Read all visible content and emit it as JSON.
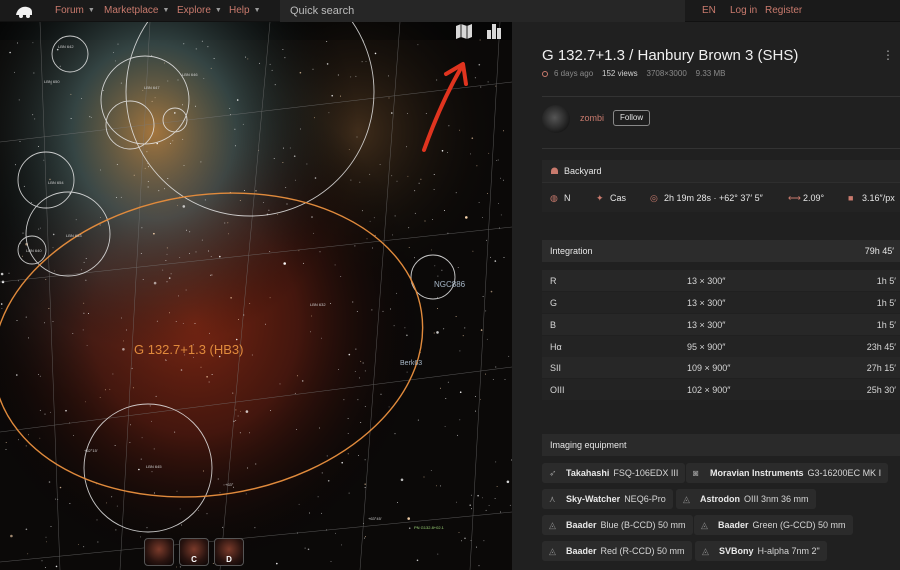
{
  "nav": {
    "items": [
      {
        "label": "Forum"
      },
      {
        "label": "Marketplace"
      },
      {
        "label": "Explore"
      },
      {
        "label": "Help"
      }
    ],
    "search_placeholder": "Quick search",
    "lang": "EN",
    "login": "Log in",
    "register": "Register"
  },
  "viewer": {
    "object_label": "G 132.7+1.3 (HB3)",
    "annotations": [
      "NGC886",
      "Berk63",
      "LBN 642",
      "LBN 646",
      "LBN 647",
      "LBN 650",
      "LBN 654",
      "LBN 653",
      "LBN 645",
      "LBN 640",
      "LBN 632"
    ],
    "coords": [
      "+62°15'",
      "+63°",
      "+63°45'",
      "PN G132.8+02.1"
    ],
    "thumbnails": [
      {
        "label": ""
      },
      {
        "label": "C"
      },
      {
        "label": "D"
      }
    ]
  },
  "panel": {
    "title": "G 132.7+1.3 / Hanbury Brown 3 (SHS)",
    "age": "6 days ago",
    "views": "152 views",
    "resolution": "3708×3000",
    "size": "9.33 MB",
    "user": "zombi",
    "follow_label": "Follow",
    "location": "Backyard",
    "hemisphere": "N",
    "constellation": "Cas",
    "ra": "2h 19m 28s · +62° 37′ 5″",
    "fov": "2.09°",
    "scale": "3.16″/px",
    "integration_label": "Integration",
    "integration_total": "79h 45′",
    "filters": [
      {
        "name": "R",
        "count": "13 × 300″",
        "time": "1h 5′"
      },
      {
        "name": "G",
        "count": "13 × 300″",
        "time": "1h 5′"
      },
      {
        "name": "B",
        "count": "13 × 300″",
        "time": "1h 5′"
      },
      {
        "name": "Hα",
        "count": "95 × 900″",
        "time": "23h 45′"
      },
      {
        "name": "SII",
        "count": "109 × 900″",
        "time": "27h 15′"
      },
      {
        "name": "OIII",
        "count": "102 × 900″",
        "time": "25h 30′"
      }
    ],
    "equipment_label": "Imaging equipment",
    "equipment": [
      {
        "icon": "telescope-icon",
        "brand": "Takahashi",
        "model": "FSQ-106EDX III"
      },
      {
        "icon": "camera-icon",
        "brand": "Moravian Instruments",
        "model": "G3-16200EC MK I"
      },
      {
        "icon": "mount-icon",
        "brand": "Sky-Watcher",
        "model": "NEQ6-Pro"
      },
      {
        "icon": "filter-icon",
        "brand": "Astrodon",
        "model": "OIII 3nm 36 mm"
      },
      {
        "icon": "filter-icon",
        "brand": "Baader",
        "model": "Blue (B-CCD) 50 mm"
      },
      {
        "icon": "filter-icon",
        "brand": "Baader",
        "model": "Green (G-CCD) 50 mm"
      },
      {
        "icon": "filter-icon",
        "brand": "Baader",
        "model": "Red (R-CCD) 50 mm"
      },
      {
        "icon": "filter-icon",
        "brand": "SVBony",
        "model": "H-alpha 7nm 2\""
      }
    ]
  },
  "colors": {
    "accent": "#c97a6d",
    "annotation_orange": "#e08a3c",
    "arrow_red": "#e0341f"
  }
}
